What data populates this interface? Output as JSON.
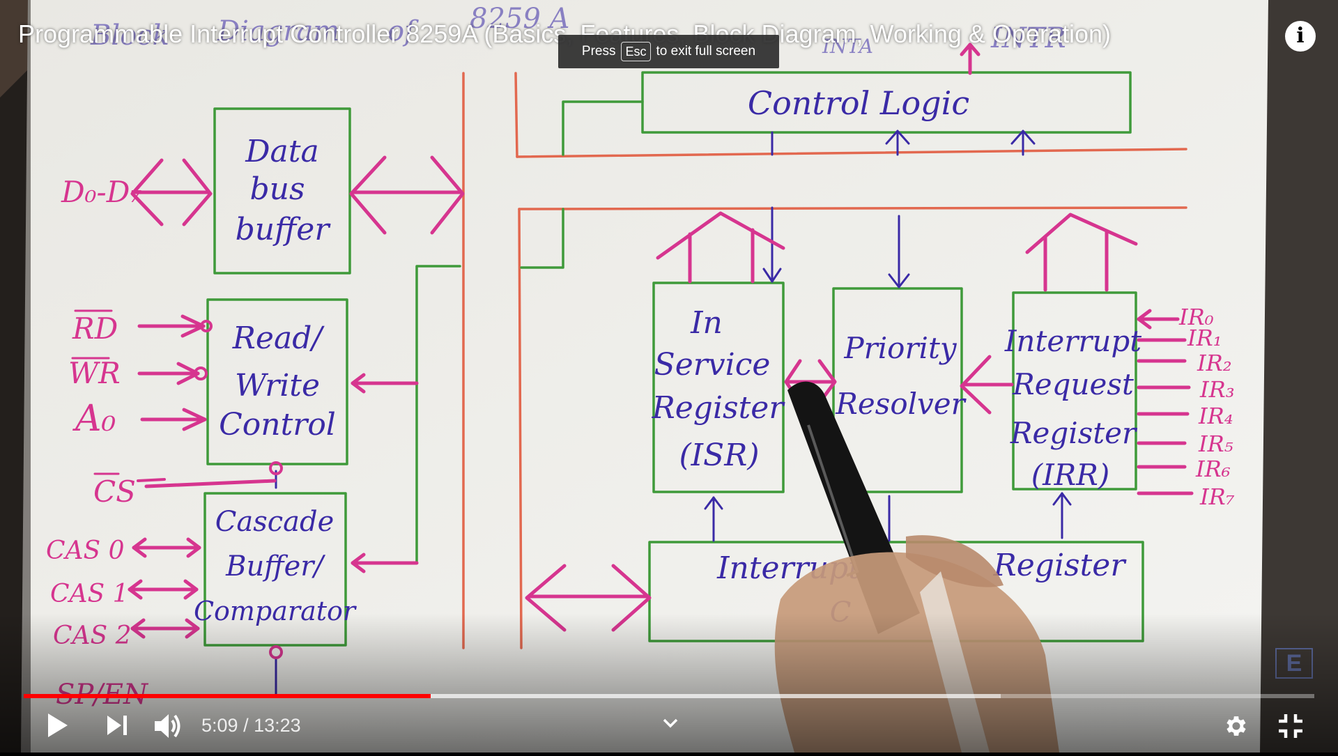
{
  "player": {
    "title": "Programmable Interrupt Controller 8259A (Basics, Features, Block Diagram, Working & Operation)",
    "fullscreen_toast": {
      "press": "Press",
      "key": "Esc",
      "suffix": "to exit full screen"
    },
    "time_current": "5:09",
    "time_separator": " / ",
    "time_total": "13:23",
    "progress_played_fraction": 0.3152,
    "progress_buffered_fraction": 0.7568,
    "accent_color": "#ff0000",
    "icons": [
      "info-icon",
      "play-icon",
      "next-icon",
      "volume-icon",
      "chevron-down-icon",
      "settings-gear-icon",
      "exit-fullscreen-icon"
    ]
  },
  "whiteboard": {
    "title_fragments": [
      "Block Diagram of 8259 A",
      "INTR",
      "INTA"
    ],
    "blocks": {
      "data_bus_buffer": "Data bus buffer",
      "read_write_control": "Read/ Write Control",
      "cascade_buffer": "Cascade Buffer/ Comparator",
      "control_logic": "Control Logic",
      "in_service_register": "In Service Register (ISR)",
      "priority_resolver": "Priority Resolver",
      "interrupt_request_register": "Interrupt Request Register (IRR)",
      "interrupt_mask_register": "Interrupt Register C"
    },
    "labels": {
      "data_lines": "D0-D7",
      "rd": "RD",
      "wr": "WR",
      "a0": "A0",
      "cs": "CS",
      "cas0": "CAS 0",
      "cas1": "CAS 1",
      "cas2": "CAS 2",
      "sp_en": "SP/EN",
      "ir_lines": [
        "IR0",
        "IR1",
        "IR2",
        "IR3",
        "IR4",
        "IR5",
        "IR6",
        "IR7"
      ]
    },
    "colors": {
      "paper": "#f2f2ee",
      "block_border": "#3f9a3a",
      "bus_line": "#e2684f",
      "arrow": "#d6358f",
      "ink": "#3a2aa6",
      "pen": "#121212",
      "hand": "#c79a7a"
    }
  }
}
